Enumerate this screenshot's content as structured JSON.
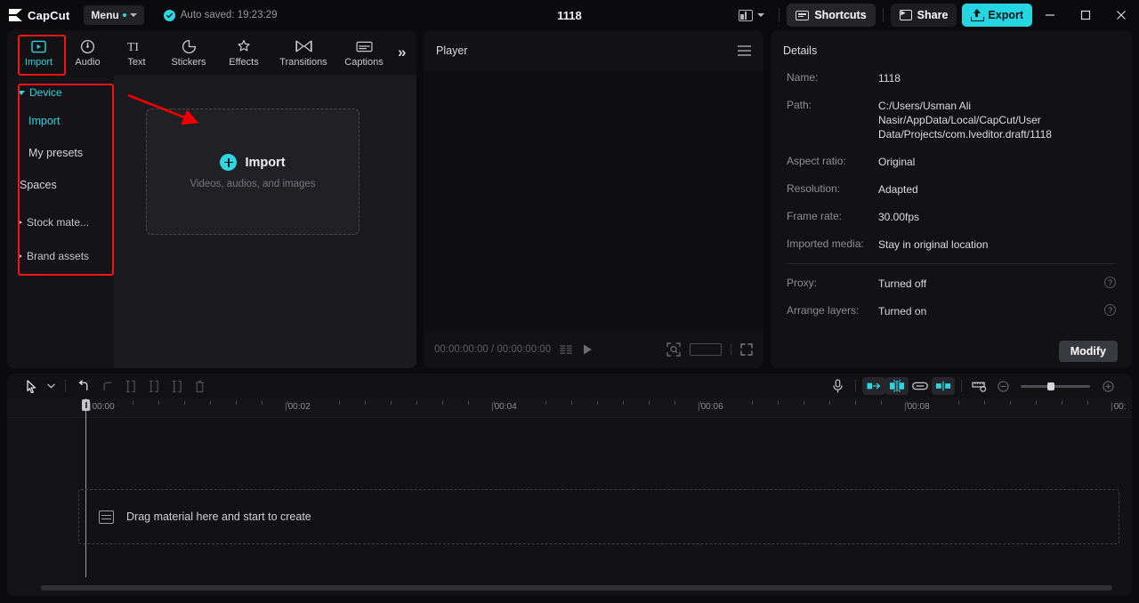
{
  "titlebar": {
    "brand": "CapCut",
    "menu_label": "Menu",
    "autosave_text": "Auto saved: 19:23:29",
    "project_title": "1118",
    "layout_icon": "panel-layout-icon",
    "shortcuts_label": "Shortcuts",
    "share_label": "Share",
    "export_label": "Export",
    "minimize": "minimize-icon",
    "maximize": "maximize-icon",
    "close": "close-icon",
    "accent_color": "#25d6e0"
  },
  "tabs": [
    {
      "label": "Import",
      "icon": "import-icon",
      "active": true
    },
    {
      "label": "Audio",
      "icon": "audio-note-icon",
      "active": false
    },
    {
      "label": "Text",
      "icon": "text-ti-icon",
      "active": false
    },
    {
      "label": "Stickers",
      "icon": "sticker-icon",
      "active": false
    },
    {
      "label": "Effects",
      "icon": "effects-sparkle-icon",
      "active": false
    },
    {
      "label": "Transitions",
      "icon": "transitions-icon",
      "active": false
    },
    {
      "label": "Captions",
      "icon": "captions-icon",
      "active": false
    }
  ],
  "tabs_more": "»",
  "sidebar": {
    "groups": [
      {
        "label": "Device",
        "expanded": true,
        "type": "group"
      },
      {
        "label": "Import",
        "type": "sub",
        "active": true
      },
      {
        "label": "My presets",
        "type": "sub",
        "active": false
      },
      {
        "label": "Spaces",
        "type": "sub-flat",
        "active": false
      },
      {
        "label": "Stock mate...",
        "expanded": false,
        "type": "group"
      },
      {
        "label": "Brand assets",
        "expanded": false,
        "type": "group"
      }
    ]
  },
  "dropzone": {
    "title": "Import",
    "subtitle": "Videos, audios, and images",
    "icon": "plus-circle-icon"
  },
  "player": {
    "title": "Player",
    "menu_icon": "hamburger-icon",
    "current_time": "00:00:00:00",
    "total_time": "00:00:00:00",
    "time_display": "00:00:00:00 / 00:00:00:00",
    "quality_icon": "quality-bars-icon",
    "play_icon": "play-icon",
    "crop_icon": "crop-focus-icon",
    "ratio_icon": "aspect-ratio-icon",
    "fullscreen_icon": "fullscreen-icon"
  },
  "details": {
    "title": "Details",
    "rows": [
      {
        "label": "Name:",
        "value": "1118"
      },
      {
        "label": "Path:",
        "value": "C:/Users/Usman Ali Nasir/AppData/Local/CapCut/User Data/Projects/com.lveditor.draft/1118"
      },
      {
        "label": "Aspect ratio:",
        "value": "Original"
      },
      {
        "label": "Resolution:",
        "value": "Adapted"
      },
      {
        "label": "Frame rate:",
        "value": "30.00fps"
      },
      {
        "label": "Imported media:",
        "value": "Stay in original location"
      }
    ],
    "rows_below": [
      {
        "label": "Proxy:",
        "value": "Turned off",
        "help": "help-icon"
      },
      {
        "label": "Arrange layers:",
        "value": "Turned on",
        "help": "help-icon"
      }
    ],
    "modify_label": "Modify"
  },
  "timeline": {
    "tools": [
      {
        "name": "select-cursor-icon",
        "enabled": true
      },
      {
        "name": "cursor-dropdown-icon",
        "enabled": true
      },
      {
        "name": "undo-icon",
        "enabled": true
      },
      {
        "name": "redo-icon",
        "enabled": false
      },
      {
        "name": "split-icon",
        "enabled": false
      },
      {
        "name": "trim-left-icon",
        "enabled": false
      },
      {
        "name": "trim-right-icon",
        "enabled": false
      },
      {
        "name": "delete-icon",
        "enabled": false
      }
    ],
    "right_tools": [
      {
        "name": "microphone-icon",
        "active": false
      },
      {
        "name": "auto-cut-icon",
        "active": true
      },
      {
        "name": "speed-ramp-icon",
        "active": true
      },
      {
        "name": "link-icon",
        "active": false
      },
      {
        "name": "mirror-split-icon",
        "active": true
      },
      {
        "name": "measure-icon",
        "active": false
      },
      {
        "name": "zoom-out-icon",
        "active": false
      },
      {
        "name": "zoom-in-icon",
        "active": false
      }
    ],
    "ruler_labels": [
      "00:00",
      "00:02",
      "00:04",
      "00:06",
      "00:08",
      "00:"
    ],
    "empty_track_text": "Drag material here and start to create",
    "empty_track_icon": "track-strip-icon"
  }
}
